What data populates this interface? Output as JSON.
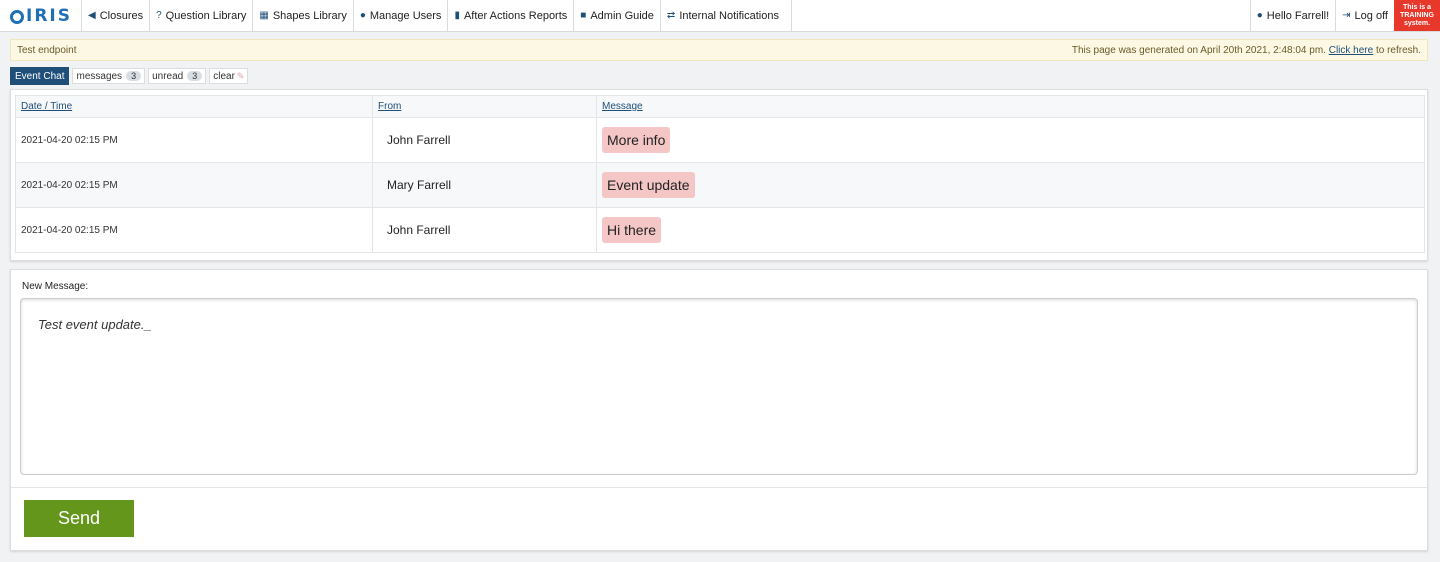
{
  "nav": {
    "logo": "IRIS",
    "items": [
      {
        "icon": "megaphone-icon",
        "glyph": "◀",
        "label": "Closures"
      },
      {
        "icon": "question-circle-icon",
        "glyph": "?",
        "label": "Question Library"
      },
      {
        "icon": "map-icon",
        "glyph": "▦",
        "label": "Shapes Library"
      },
      {
        "icon": "users-icon",
        "glyph": "●",
        "label": "Manage Users"
      },
      {
        "icon": "bar-chart-icon",
        "glyph": "▮",
        "label": "After Actions Reports"
      },
      {
        "icon": "book-icon",
        "glyph": "■",
        "label": "Admin Guide"
      },
      {
        "icon": "exchange-circle-icon",
        "glyph": "⇄",
        "label": "Internal Notifications"
      }
    ],
    "greeting": "Hello Farrell!",
    "logoff": "Log off",
    "training": "This is a TRAINING system."
  },
  "notice": {
    "left": "Test endpoint",
    "right_prefix": "This page was generated on April 20th 2021, 2:48:04 pm.",
    "link": "Click here",
    "right_suffix": "to refresh."
  },
  "chatbar": {
    "title": "Event Chat",
    "messages_label": "messages",
    "messages_count": "3",
    "unread_label": "unread",
    "unread_count": "3",
    "clear_label": "clear"
  },
  "table": {
    "headers": [
      "Date / Time",
      "From",
      "Message"
    ],
    "rows": [
      {
        "datetime": "2021-04-20 02:15 PM",
        "from": "John Farrell",
        "message": "More info"
      },
      {
        "datetime": "2021-04-20 02:15 PM",
        "from": "Mary Farrell",
        "message": "Event update"
      },
      {
        "datetime": "2021-04-20 02:15 PM",
        "from": "John Farrell",
        "message": "Hi there"
      }
    ]
  },
  "compose": {
    "label": "New Message:",
    "value": "Test event update._",
    "send_label": "Send"
  },
  "colors": {
    "brand": "#1f4e79",
    "message_bg": "#f4c6c6",
    "send_button": "#64961c",
    "training_badge": "#e8382c",
    "notice_bg": "#fcf8e3"
  }
}
